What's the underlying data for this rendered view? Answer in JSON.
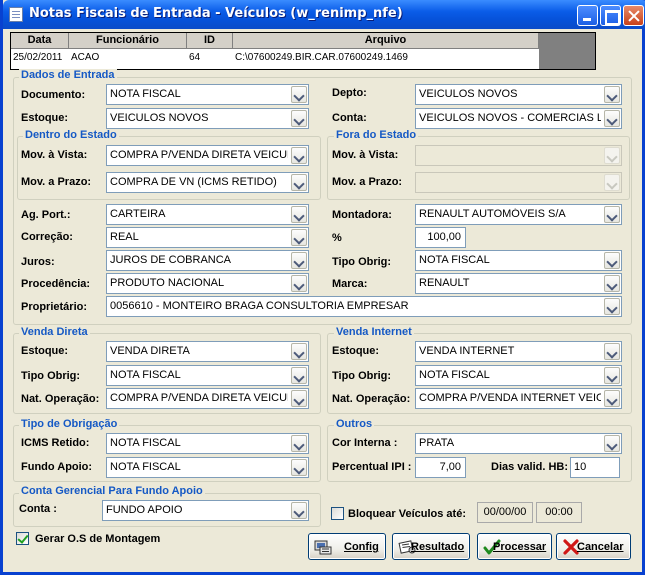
{
  "window": {
    "title": "Notas Fiscais de Entrada - Veículos (w_renimp_nfe)"
  },
  "grid": {
    "columns": [
      "Data",
      "Funcionário",
      "ID",
      "Arquivo"
    ],
    "row": {
      "data": "25/02/2011",
      "funcionario": "ACAO",
      "id": "64",
      "arquivo": "C:\\07600249.BIR.CAR.07600249.1469"
    }
  },
  "dados_entrada": {
    "title": "Dados de Entrada",
    "documento_label": "Documento:",
    "documento_value": "NOTA FISCAL",
    "estoque_label": "Estoque:",
    "estoque_value": "VEICULOS NOVOS",
    "depto_label": "Depto:",
    "depto_value": "VEICULOS NOVOS",
    "conta_label": "Conta:",
    "conta_value": "VEICULOS NOVOS - COMERCIAS LEVES"
  },
  "dentro_estado": {
    "title": "Dentro do Estado",
    "vista_label": "Mov. à Vista:",
    "vista_value": "COMPRA P/VENDA DIRETA VEICULOS",
    "prazo_label": "Mov. a Prazo:",
    "prazo_value": "COMPRA DE VN (ICMS RETIDO)"
  },
  "fora_estado": {
    "title": "Fora do Estado",
    "vista_label": "Mov. à Vista:",
    "vista_value": "",
    "prazo_label": "Mov. a Prazo:",
    "prazo_value": ""
  },
  "outros_campos": {
    "agport_label": "Ag. Port.:",
    "agport_value": "CARTEIRA",
    "correcao_label": "Correção:",
    "correcao_value": "REAL",
    "juros_label": "Juros:",
    "juros_value": "JUROS DE COBRANCA",
    "procedencia_label": "Procedência:",
    "procedencia_value": "PRODUTO NACIONAL",
    "montadora_label": "Montadora:",
    "montadora_value": "RENAULT AUTOMÓVEIS S/A",
    "pct_label": "%",
    "pct_value": "100,00",
    "tipo_obrig_label": "Tipo Obrig:",
    "tipo_obrig_value": "NOTA FISCAL",
    "marca_label": "Marca:",
    "marca_value": "RENAULT",
    "proprietario_label": "Proprietário:",
    "proprietario_value": "0056610 - MONTEIRO BRAGA CONSULTORIA EMPRESAR"
  },
  "venda_direta": {
    "title": "Venda Direta",
    "estoque_label": "Estoque:",
    "estoque_value": "VENDA DIRETA",
    "tipo_label": "Tipo Obrig:",
    "tipo_value": "NOTA FISCAL",
    "nat_label": "Nat. Operação:",
    "nat_value": "COMPRA P/VENDA DIRETA VEICULOS"
  },
  "venda_internet": {
    "title": "Venda Internet",
    "estoque_label": "Estoque:",
    "estoque_value": "VENDA INTERNET",
    "tipo_label": "Tipo Obrig:",
    "tipo_value": "NOTA FISCAL",
    "nat_label": "Nat. Operação:",
    "nat_value": "COMPRA P/VENDA INTERNET VEICULOS"
  },
  "tipo_obrigacao": {
    "title": "Tipo de Obrigação",
    "icms_label": "ICMS Retido:",
    "icms_value": "NOTA FISCAL",
    "fundo_label": "Fundo Apoio:",
    "fundo_value": "NOTA FISCAL"
  },
  "outros": {
    "title": "Outros",
    "cor_label": "Cor Interna :",
    "cor_value": "PRATA",
    "ipi_label": "Percentual IPI :",
    "ipi_value": "7,00",
    "dias_label": "Dias valid. HB:",
    "dias_value": "10"
  },
  "conta_gerencial": {
    "title": "Conta Gerencial Para Fundo Apoio",
    "conta_label": "Conta :",
    "conta_value": "FUNDO APOIO"
  },
  "bloquear": {
    "label": "Bloquear Veículos até:",
    "date": "00/00/00",
    "time": "00:00",
    "checked": false
  },
  "gerar_os": {
    "label": "Gerar O.S de Montagem",
    "checked": true
  },
  "buttons": {
    "config": "Config",
    "resultado": "Resultado",
    "processar": "Processar",
    "cancelar": "Cancelar"
  },
  "icons": {
    "config": "config-icon",
    "resultado": "resultado-icon",
    "processar": "check-icon",
    "cancelar": "cancel-x-icon"
  },
  "colors": {
    "title_bar": "#0a5ce8",
    "group_title": "#1559c5",
    "window_bg": "#ece9d8"
  }
}
